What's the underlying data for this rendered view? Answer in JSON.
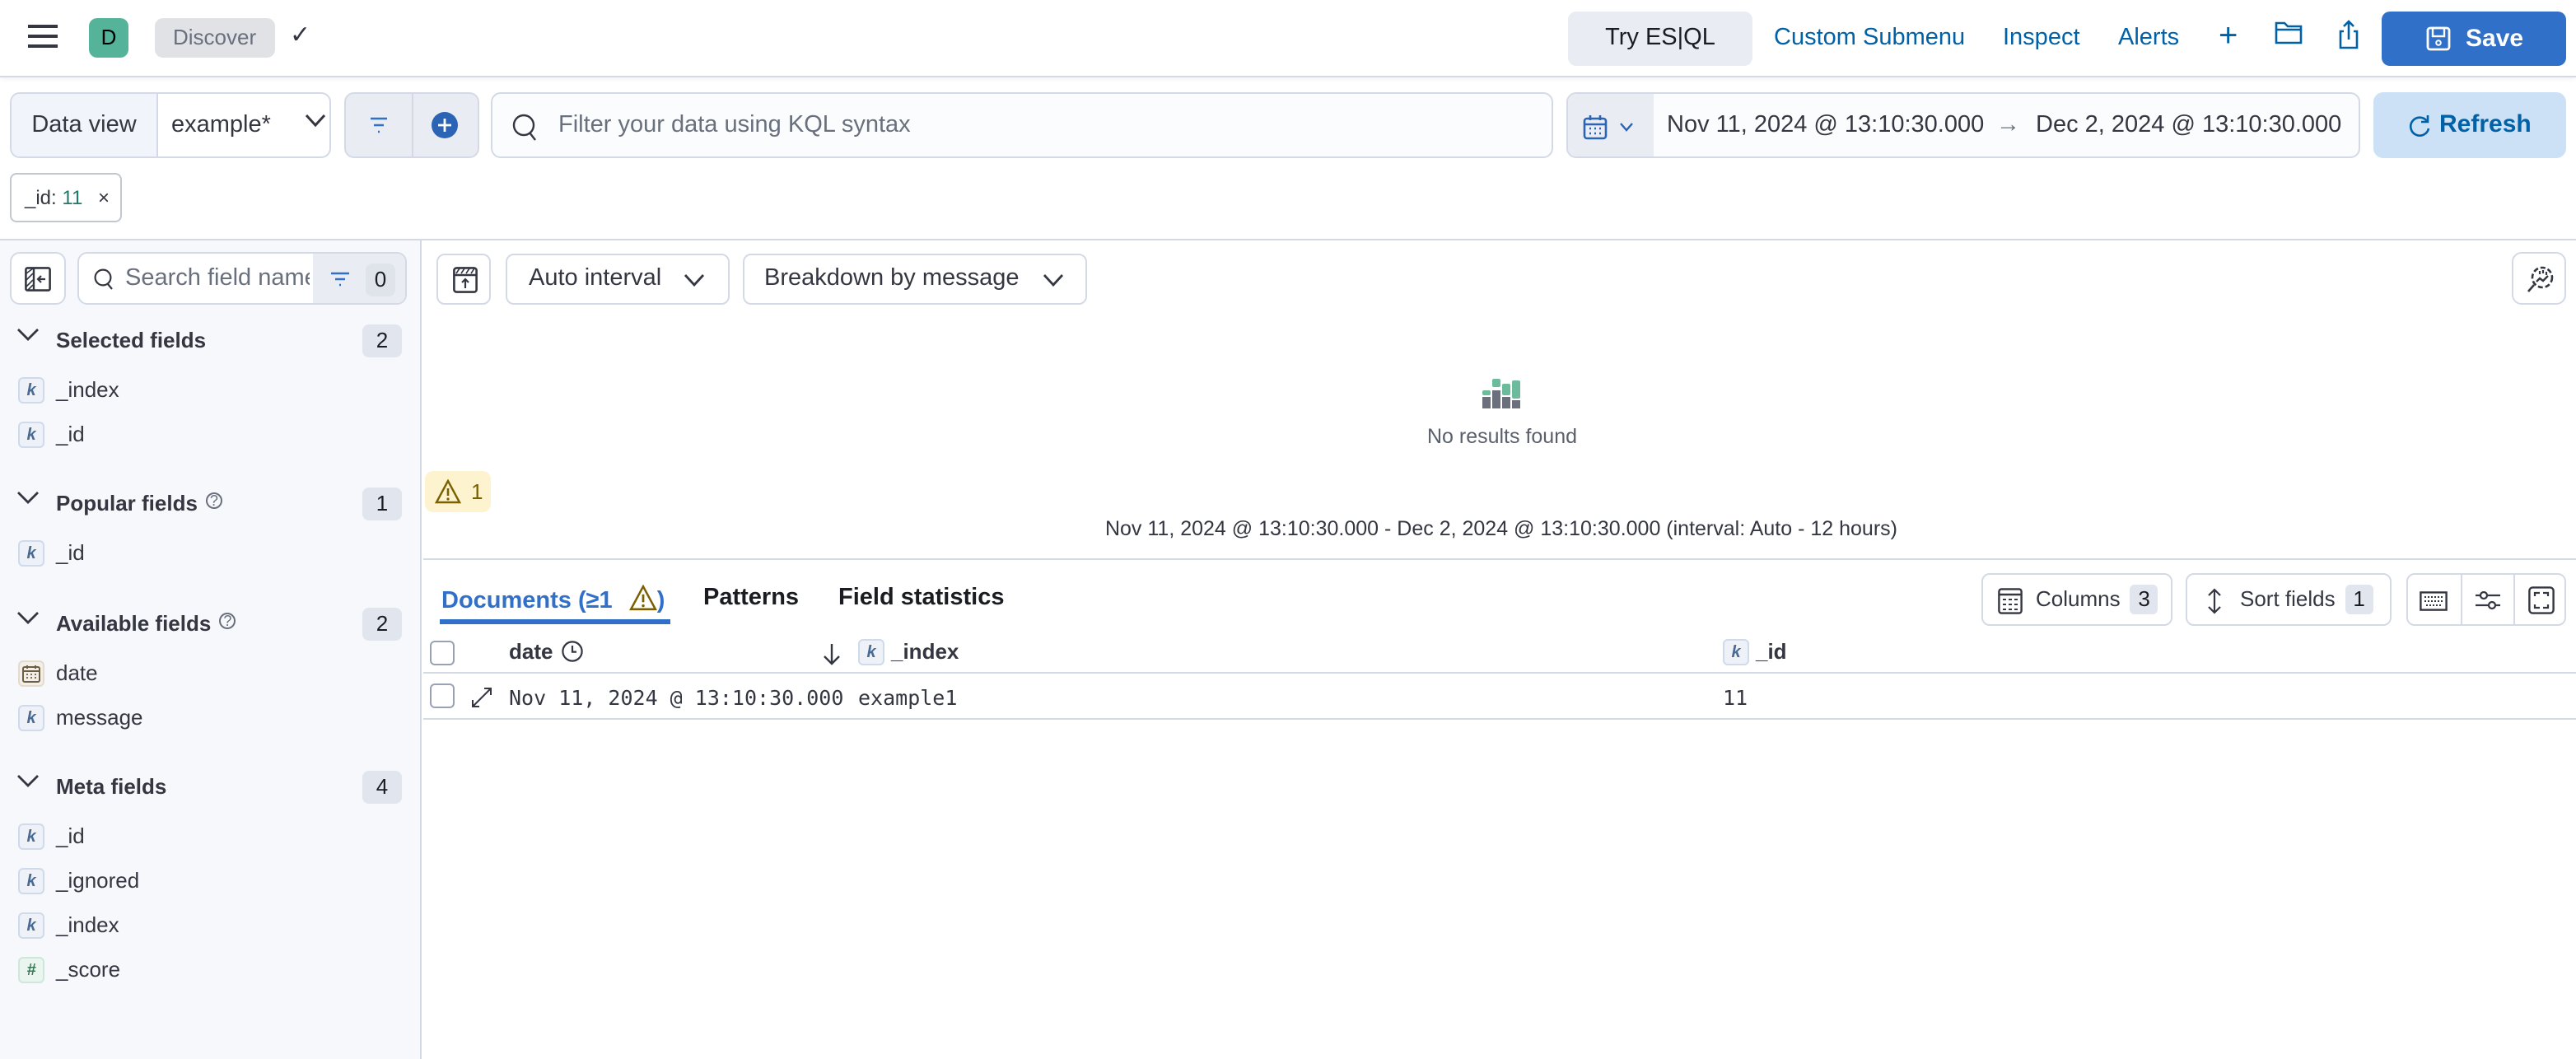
{
  "header": {
    "avatar_letter": "D",
    "breadcrumb": "Discover",
    "try_esql": "Try ES|QL",
    "links": [
      "Custom Submenu",
      "Inspect",
      "Alerts"
    ],
    "save_label": "Save"
  },
  "query_bar": {
    "data_view_label": "Data view",
    "data_view_value": "example*",
    "kql_placeholder": "Filter your data using KQL syntax",
    "kql_value": "",
    "start_date": "Nov 11, 2024 @ 13:10:30.000",
    "end_date": "Dec 2, 2024 @ 13:10:30.000",
    "refresh_label": "Refresh"
  },
  "filters": [
    {
      "field": "_id:",
      "value": "11"
    }
  ],
  "sidebar": {
    "search_placeholder": "Search field names",
    "filter_count": "0",
    "sections": [
      {
        "title": "Selected fields",
        "count": "2",
        "help": false,
        "fields": [
          {
            "type": "k",
            "name": "_index"
          },
          {
            "type": "k",
            "name": "_id"
          }
        ]
      },
      {
        "title": "Popular fields",
        "count": "1",
        "help": true,
        "fields": [
          {
            "type": "k",
            "name": "_id"
          }
        ]
      },
      {
        "title": "Available fields",
        "count": "2",
        "help": true,
        "fields": [
          {
            "type": "date",
            "name": "date"
          },
          {
            "type": "k",
            "name": "message"
          }
        ]
      },
      {
        "title": "Meta fields",
        "count": "4",
        "help": false,
        "fields": [
          {
            "type": "k",
            "name": "_id"
          },
          {
            "type": "k",
            "name": "_ignored"
          },
          {
            "type": "k",
            "name": "_index"
          },
          {
            "type": "#",
            "name": "_score"
          }
        ]
      }
    ]
  },
  "chart_toolbar": {
    "interval_label": "Auto interval",
    "breakdown_label": "Breakdown by message"
  },
  "histogram": {
    "warning_count": "1",
    "empty_message": "No results found",
    "range_text": "Nov 11, 2024 @ 13:10:30.000 - Dec 2, 2024 @ 13:10:30.000 (interval: Auto - 12 hours)"
  },
  "tabs": [
    {
      "label": "Documents (≥1",
      "active": true
    },
    {
      "label": "Patterns",
      "active": false
    },
    {
      "label": "Field statistics",
      "active": false
    }
  ],
  "grid_toolbar": {
    "columns_label": "Columns",
    "columns_count": "3",
    "sort_label": "Sort fields",
    "sort_count": "1"
  },
  "table": {
    "columns": [
      {
        "name": "date",
        "type": "date"
      },
      {
        "name": "_index",
        "type": "k"
      },
      {
        "name": "_id",
        "type": "k"
      }
    ],
    "rows": [
      {
        "date": "Nov 11, 2024 @ 13:10:30.000",
        "_index": "example1",
        "_id": "11"
      }
    ]
  },
  "colors": {
    "primary": "#3170c8",
    "link": "#0061a6",
    "avatar": "#54b399",
    "warning_bg": "#fdf3cf"
  }
}
